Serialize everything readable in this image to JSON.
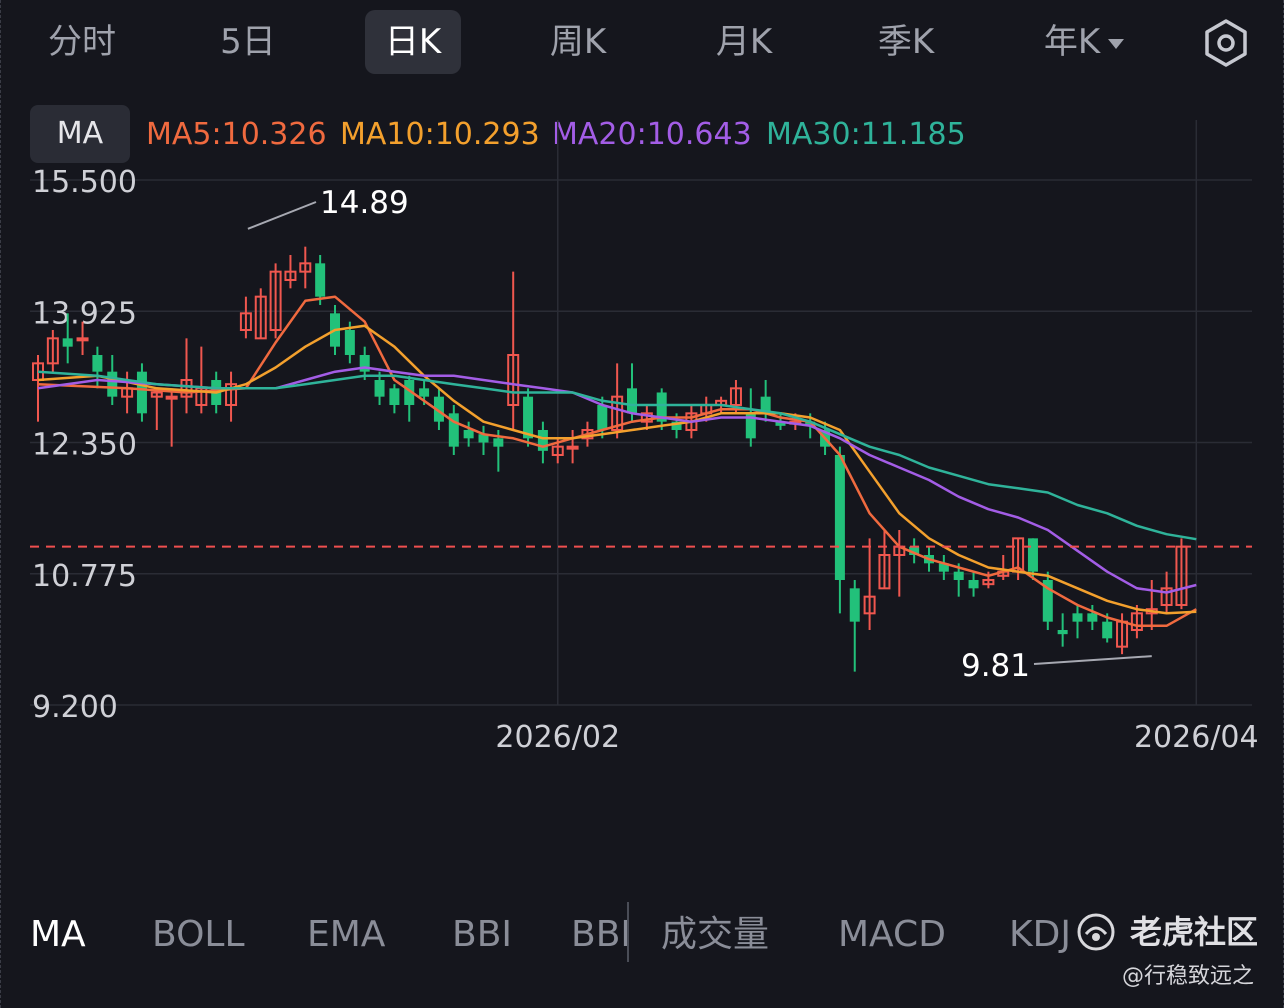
{
  "tabs": [
    {
      "label": "分时",
      "active": false
    },
    {
      "label": "5日",
      "active": false
    },
    {
      "label": "日K",
      "active": true
    },
    {
      "label": "周K",
      "active": false
    },
    {
      "label": "月K",
      "active": false
    },
    {
      "label": "季K",
      "active": false
    },
    {
      "label": "年K",
      "active": false,
      "has_dropdown": true
    }
  ],
  "settings_icon": "settings-gear-icon",
  "ma_button": "MA",
  "ma_legend": [
    {
      "text": "MA5:10.326",
      "color": "#f06a3f"
    },
    {
      "text": "MA10:10.293",
      "color": "#f3a02d"
    },
    {
      "text": "MA20:10.643",
      "color": "#a35de6"
    },
    {
      "text": "MA30:11.185",
      "color": "#2fb39a"
    }
  ],
  "colors": {
    "up": "#f0574f",
    "down": "#22c17a",
    "grid": "#2a2c35",
    "current_price_line": "#ef4f4f",
    "axis_text": "#cfd0d6"
  },
  "chart_data": {
    "type": "candlestick",
    "y_ticks": [
      "15.500",
      "13.925",
      "12.350",
      "10.775",
      "9.200"
    ],
    "y_tick_values": [
      15.5,
      13.925,
      12.35,
      10.775,
      9.2
    ],
    "ylim": [
      9.2,
      15.5
    ],
    "x_tick_labels": [
      {
        "label": "2026/02",
        "index": 35
      },
      {
        "label": "2026/04",
        "index": 78
      }
    ],
    "high_annotation": {
      "label": "14.89",
      "value": 14.89,
      "index": 14
    },
    "low_annotation": {
      "label": "9.81",
      "value": 9.81,
      "index": 75
    },
    "current_price": 11.1,
    "candles": [
      [
        13.1,
        13.3,
        12.6,
        13.4
      ],
      [
        13.3,
        13.6,
        13.2,
        13.7
      ],
      [
        13.6,
        13.5,
        13.3,
        13.9
      ],
      [
        13.6,
        13.6,
        13.4,
        13.8
      ],
      [
        13.4,
        13.2,
        13.0,
        13.5
      ],
      [
        13.2,
        12.9,
        12.8,
        13.4
      ],
      [
        12.9,
        13.0,
        12.7,
        13.2
      ],
      [
        13.2,
        12.7,
        12.6,
        13.3
      ],
      [
        12.9,
        12.95,
        12.5,
        13.0
      ],
      [
        12.9,
        12.9,
        12.3,
        13.0
      ],
      [
        12.9,
        13.1,
        12.7,
        13.6
      ],
      [
        12.8,
        13.0,
        12.7,
        13.5
      ],
      [
        13.1,
        12.8,
        12.7,
        13.2
      ],
      [
        12.8,
        13.05,
        12.6,
        13.2
      ],
      [
        13.7,
        13.9,
        13.6,
        14.1
      ],
      [
        13.6,
        14.1,
        13.6,
        14.2
      ],
      [
        13.7,
        14.4,
        13.6,
        14.5
      ],
      [
        14.3,
        14.4,
        14.2,
        14.6
      ],
      [
        14.4,
        14.5,
        14.2,
        14.7
      ],
      [
        14.5,
        14.1,
        14.0,
        14.6
      ],
      [
        13.9,
        13.5,
        13.4,
        14.0
      ],
      [
        13.7,
        13.4,
        13.3,
        13.8
      ],
      [
        13.4,
        13.2,
        13.1,
        13.5
      ],
      [
        13.1,
        12.9,
        12.8,
        13.2
      ],
      [
        13.0,
        12.8,
        12.7,
        13.05
      ],
      [
        13.1,
        12.8,
        12.6,
        13.15
      ],
      [
        13.0,
        12.9,
        12.8,
        13.1
      ],
      [
        12.9,
        12.6,
        12.5,
        13.0
      ],
      [
        12.7,
        12.3,
        12.2,
        12.8
      ],
      [
        12.5,
        12.4,
        12.3,
        12.6
      ],
      [
        12.45,
        12.35,
        12.2,
        12.55
      ],
      [
        12.4,
        12.3,
        12.0,
        12.5
      ],
      [
        12.8,
        13.4,
        12.5,
        14.4
      ],
      [
        12.9,
        12.4,
        12.3,
        13.0
      ],
      [
        12.5,
        12.25,
        12.1,
        12.6
      ],
      [
        12.2,
        12.3,
        12.1,
        12.4
      ],
      [
        12.3,
        12.3,
        12.1,
        12.5
      ],
      [
        12.4,
        12.5,
        12.3,
        12.6
      ],
      [
        12.8,
        12.5,
        12.4,
        12.9
      ],
      [
        12.5,
        12.9,
        12.4,
        13.3
      ],
      [
        13.0,
        12.7,
        12.6,
        13.3
      ],
      [
        12.6,
        12.7,
        12.5,
        12.8
      ],
      [
        12.95,
        12.6,
        12.5,
        13.0
      ],
      [
        12.6,
        12.5,
        12.4,
        12.7
      ],
      [
        12.5,
        12.7,
        12.4,
        12.8
      ],
      [
        12.7,
        12.8,
        12.6,
        12.9
      ],
      [
        12.8,
        12.85,
        12.7,
        12.9
      ],
      [
        12.8,
        13.0,
        12.7,
        13.1
      ],
      [
        12.7,
        12.4,
        12.3,
        13.0
      ],
      [
        12.9,
        12.7,
        12.6,
        13.1
      ],
      [
        12.6,
        12.55,
        12.5,
        12.7
      ],
      [
        12.6,
        12.6,
        12.5,
        12.7
      ],
      [
        12.6,
        12.55,
        12.4,
        12.7
      ],
      [
        12.5,
        12.3,
        12.2,
        12.6
      ],
      [
        12.2,
        10.7,
        10.3,
        12.3
      ],
      [
        10.6,
        10.2,
        9.6,
        10.7
      ],
      [
        10.3,
        10.5,
        10.1,
        11.2
      ],
      [
        10.6,
        11.0,
        10.6,
        11.3
      ],
      [
        11.0,
        11.1,
        10.5,
        11.3
      ],
      [
        11.1,
        11.0,
        10.9,
        11.2
      ],
      [
        11.0,
        10.9,
        10.8,
        11.1
      ],
      [
        10.9,
        10.8,
        10.7,
        11.0
      ],
      [
        10.8,
        10.7,
        10.5,
        10.9
      ],
      [
        10.7,
        10.6,
        10.5,
        10.8
      ],
      [
        10.65,
        10.7,
        10.6,
        10.8
      ],
      [
        10.75,
        10.8,
        10.7,
        11.0
      ],
      [
        10.8,
        11.2,
        10.7,
        11.2
      ],
      [
        11.2,
        10.8,
        10.7,
        11.2
      ],
      [
        10.7,
        10.2,
        10.1,
        10.8
      ],
      [
        10.1,
        10.05,
        9.9,
        10.3
      ],
      [
        10.3,
        10.2,
        10.0,
        10.4
      ],
      [
        10.3,
        10.2,
        10.1,
        10.4
      ],
      [
        10.2,
        10.0,
        9.95,
        10.3
      ],
      [
        9.9,
        10.2,
        9.81,
        10.3
      ],
      [
        10.1,
        10.3,
        10.0,
        10.4
      ],
      [
        10.3,
        10.35,
        10.1,
        10.7
      ],
      [
        10.4,
        10.6,
        10.3,
        10.8
      ],
      [
        10.4,
        11.1,
        10.35,
        11.2
      ]
    ],
    "ma_series": [
      {
        "name": "MA5",
        "color": "#f06a3f",
        "points": [
          [
            0,
            13.05
          ],
          [
            6,
            13.0
          ],
          [
            10,
            12.95
          ],
          [
            14,
            13.0
          ],
          [
            16,
            13.55
          ],
          [
            18,
            14.05
          ],
          [
            20,
            14.1
          ],
          [
            22,
            13.8
          ],
          [
            24,
            13.1
          ],
          [
            26,
            12.85
          ],
          [
            28,
            12.6
          ],
          [
            30,
            12.45
          ],
          [
            32,
            12.4
          ],
          [
            34,
            12.3
          ],
          [
            36,
            12.4
          ],
          [
            38,
            12.5
          ],
          [
            40,
            12.6
          ],
          [
            42,
            12.65
          ],
          [
            44,
            12.65
          ],
          [
            46,
            12.75
          ],
          [
            48,
            12.75
          ],
          [
            50,
            12.65
          ],
          [
            52,
            12.6
          ],
          [
            54,
            12.2
          ],
          [
            56,
            11.5
          ],
          [
            58,
            11.1
          ],
          [
            60,
            10.95
          ],
          [
            62,
            10.85
          ],
          [
            64,
            10.75
          ],
          [
            66,
            10.85
          ],
          [
            68,
            10.6
          ],
          [
            70,
            10.4
          ],
          [
            72,
            10.25
          ],
          [
            74,
            10.15
          ],
          [
            76,
            10.15
          ],
          [
            78,
            10.35
          ]
        ]
      },
      {
        "name": "MA10",
        "color": "#f3a02d",
        "points": [
          [
            0,
            13.1
          ],
          [
            4,
            13.15
          ],
          [
            8,
            13.0
          ],
          [
            12,
            12.95
          ],
          [
            14,
            13.05
          ],
          [
            16,
            13.25
          ],
          [
            18,
            13.5
          ],
          [
            20,
            13.7
          ],
          [
            22,
            13.75
          ],
          [
            24,
            13.5
          ],
          [
            26,
            13.15
          ],
          [
            28,
            12.85
          ],
          [
            30,
            12.6
          ],
          [
            32,
            12.5
          ],
          [
            34,
            12.4
          ],
          [
            36,
            12.4
          ],
          [
            38,
            12.45
          ],
          [
            40,
            12.5
          ],
          [
            42,
            12.55
          ],
          [
            44,
            12.6
          ],
          [
            46,
            12.7
          ],
          [
            48,
            12.7
          ],
          [
            50,
            12.7
          ],
          [
            52,
            12.65
          ],
          [
            54,
            12.5
          ],
          [
            56,
            12.0
          ],
          [
            58,
            11.5
          ],
          [
            60,
            11.2
          ],
          [
            62,
            11.0
          ],
          [
            64,
            10.85
          ],
          [
            66,
            10.8
          ],
          [
            68,
            10.75
          ],
          [
            70,
            10.6
          ],
          [
            72,
            10.45
          ],
          [
            74,
            10.35
          ],
          [
            76,
            10.3
          ],
          [
            78,
            10.32
          ]
        ]
      },
      {
        "name": "MA20",
        "color": "#a35de6",
        "points": [
          [
            0,
            13.0
          ],
          [
            4,
            13.1
          ],
          [
            8,
            13.05
          ],
          [
            12,
            13.0
          ],
          [
            16,
            13.0
          ],
          [
            18,
            13.1
          ],
          [
            20,
            13.2
          ],
          [
            22,
            13.25
          ],
          [
            24,
            13.2
          ],
          [
            26,
            13.15
          ],
          [
            28,
            13.15
          ],
          [
            30,
            13.1
          ],
          [
            32,
            13.05
          ],
          [
            34,
            13.0
          ],
          [
            36,
            12.95
          ],
          [
            38,
            12.8
          ],
          [
            40,
            12.7
          ],
          [
            42,
            12.65
          ],
          [
            44,
            12.6
          ],
          [
            46,
            12.65
          ],
          [
            48,
            12.65
          ],
          [
            50,
            12.6
          ],
          [
            52,
            12.55
          ],
          [
            54,
            12.4
          ],
          [
            56,
            12.2
          ],
          [
            58,
            12.05
          ],
          [
            60,
            11.9
          ],
          [
            62,
            11.7
          ],
          [
            64,
            11.55
          ],
          [
            66,
            11.45
          ],
          [
            68,
            11.3
          ],
          [
            70,
            11.05
          ],
          [
            72,
            10.8
          ],
          [
            74,
            10.6
          ],
          [
            76,
            10.55
          ],
          [
            78,
            10.64
          ]
        ]
      },
      {
        "name": "MA30",
        "color": "#2fb39a",
        "points": [
          [
            0,
            13.2
          ],
          [
            4,
            13.15
          ],
          [
            8,
            13.05
          ],
          [
            12,
            13.0
          ],
          [
            16,
            13.0
          ],
          [
            18,
            13.05
          ],
          [
            20,
            13.1
          ],
          [
            22,
            13.15
          ],
          [
            24,
            13.15
          ],
          [
            26,
            13.1
          ],
          [
            28,
            13.05
          ],
          [
            30,
            13.0
          ],
          [
            32,
            12.95
          ],
          [
            34,
            12.95
          ],
          [
            36,
            12.95
          ],
          [
            38,
            12.85
          ],
          [
            40,
            12.8
          ],
          [
            42,
            12.8
          ],
          [
            44,
            12.8
          ],
          [
            46,
            12.8
          ],
          [
            48,
            12.75
          ],
          [
            50,
            12.7
          ],
          [
            52,
            12.6
          ],
          [
            54,
            12.45
          ],
          [
            56,
            12.3
          ],
          [
            58,
            12.2
          ],
          [
            60,
            12.05
          ],
          [
            62,
            11.95
          ],
          [
            64,
            11.85
          ],
          [
            66,
            11.8
          ],
          [
            68,
            11.75
          ],
          [
            70,
            11.6
          ],
          [
            72,
            11.5
          ],
          [
            74,
            11.35
          ],
          [
            76,
            11.25
          ],
          [
            78,
            11.19
          ]
        ]
      }
    ]
  },
  "indicators": [
    {
      "label": "MA",
      "active": true
    },
    {
      "label": "BOLL",
      "active": false
    },
    {
      "label": "EMA",
      "active": false
    },
    {
      "label": "BBI",
      "active": false
    },
    {
      "label": "BBI",
      "active": false
    },
    {
      "label": "成交量",
      "active": false
    },
    {
      "label": "MACD",
      "active": false
    },
    {
      "label": "KDJ",
      "active": false
    }
  ],
  "watermark": {
    "brand": "老虎社区",
    "user": "@行稳致远之",
    "icon": "tiger-logo-icon"
  }
}
